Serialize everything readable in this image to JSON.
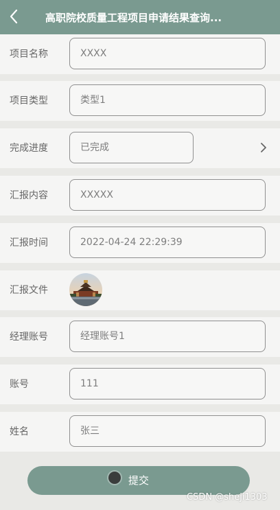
{
  "header": {
    "title": "高职院校质量工程项目申请结果查询..."
  },
  "form": {
    "project_name": {
      "label": "项目名称",
      "value": "XXXX"
    },
    "project_type": {
      "label": "项目类型",
      "value": "类型1"
    },
    "progress": {
      "label": "完成进度",
      "value": "已完成"
    },
    "report_content": {
      "label": "汇报内容",
      "value": "XXXXX"
    },
    "report_time": {
      "label": "汇报时间",
      "value": "2022-04-24 22:29:39"
    },
    "report_file": {
      "label": "汇报文件"
    },
    "manager_account": {
      "label": "经理账号",
      "value": "经理账号1"
    },
    "account": {
      "label": "账号",
      "value": "111"
    },
    "name": {
      "label": "姓名",
      "value": "张三"
    }
  },
  "submit": {
    "label": "提交"
  },
  "watermark": "CSDN @sheji1303",
  "colors": {
    "accent": "#7a9a90",
    "background": "#e9e9e6"
  }
}
